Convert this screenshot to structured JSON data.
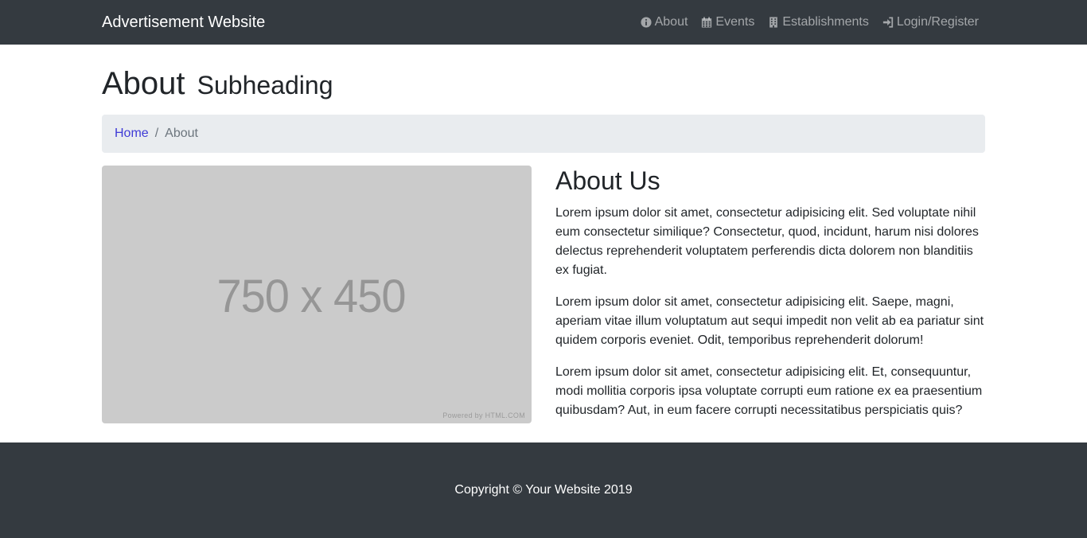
{
  "navbar": {
    "brand": "Advertisement Website",
    "items": [
      {
        "label": "About",
        "icon": "info-circle-icon"
      },
      {
        "label": "Events",
        "icon": "calendar-icon"
      },
      {
        "label": "Establishments",
        "icon": "building-icon"
      },
      {
        "label": "Login/Register",
        "icon": "sign-in-icon"
      }
    ]
  },
  "header": {
    "title": "About",
    "subtitle": "Subheading"
  },
  "breadcrumb": {
    "home": "Home",
    "separator": "/",
    "current": "About"
  },
  "placeholder_image": {
    "size_text": "750 x 450",
    "powered_text": "Powered by HTML.COM"
  },
  "about": {
    "heading": "About Us",
    "paragraphs": [
      "Lorem ipsum dolor sit amet, consectetur adipisicing elit. Sed voluptate nihil eum consectetur similique? Consectetur, quod, incidunt, harum nisi dolores delectus reprehenderit voluptatem perferendis dicta dolorem non blanditiis ex fugiat.",
      "Lorem ipsum dolor sit amet, consectetur adipisicing elit. Saepe, magni, aperiam vitae illum voluptatum aut sequi impedit non velit ab ea pariatur sint quidem corporis eveniet. Odit, temporibus reprehenderit dolorum!",
      "Lorem ipsum dolor sit amet, consectetur adipisicing elit. Et, consequuntur, modi mollitia corporis ipsa voluptate corrupti eum ratione ex ea praesentium quibusdam? Aut, in eum facere corrupti necessitatibus perspiciatis quis?"
    ]
  },
  "footer": {
    "copyright": "Copyright © Your Website 2019"
  },
  "colors": {
    "navbar_bg": "#343a40",
    "breadcrumb_bg": "#e9ecef",
    "link": "#3f3bd6",
    "placeholder_bg": "#cbcbcb"
  }
}
